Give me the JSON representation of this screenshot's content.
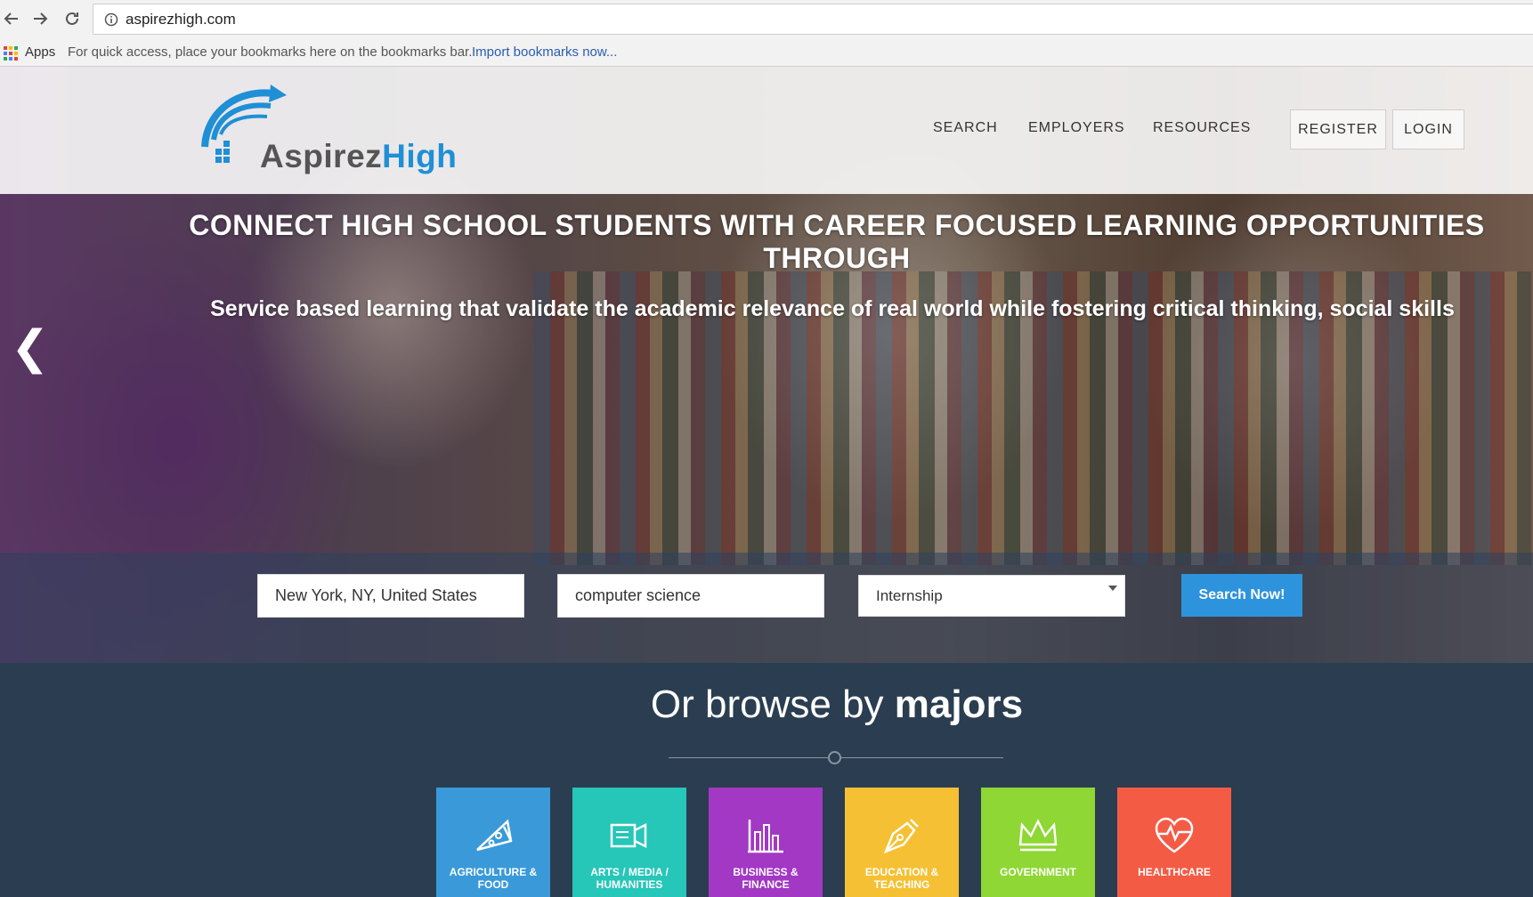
{
  "browser": {
    "url": "aspirezhigh.com",
    "bookmarks_apps_label": "Apps",
    "bookmarks_hint": "For quick access, place your bookmarks here on the bookmarks bar.",
    "bookmarks_import_link": "Import bookmarks now..."
  },
  "site": {
    "logo_text_a": "Aspirez",
    "logo_text_b": "High",
    "nav": {
      "search": "SEARCH",
      "employers": "EMPLOYERS",
      "resources": "RESOURCES",
      "register": "REGISTER",
      "login": "LOGIN"
    }
  },
  "hero": {
    "headline": "CONNECT HIGH SCHOOL STUDENTS WITH CAREER FOCUSED LEARNING OPPORTUNITIES THROUGH",
    "subline": "Service based learning that validate the academic relevance of real world while fostering critical thinking, social skills",
    "prev_arrow": "❮"
  },
  "search": {
    "location_value": "New York, NY, United States",
    "keyword_value": "computer science",
    "type_selected": "Internship",
    "button_label": "Search Now!"
  },
  "browse": {
    "title_prefix": "Or browse by",
    "title_bold": "majors",
    "majors": [
      {
        "label": "AGRICULTURE & FOOD",
        "icon": "pizza-slice-icon",
        "color": "#3a9ad9"
      },
      {
        "label": "ARTS / MEDIA / HUMANITIES",
        "icon": "media-icon",
        "color": "#26c6b9"
      },
      {
        "label": "BUSINESS & FINANCE",
        "icon": "bar-chart-icon",
        "color": "#a238c4"
      },
      {
        "label": "EDUCATION & TEACHING",
        "icon": "pen-nib-icon",
        "color": "#f5c033"
      },
      {
        "label": "GOVERNMENT",
        "icon": "crown-icon",
        "color": "#8ed734"
      },
      {
        "label": "HEALTHCARE",
        "icon": "heart-pulse-icon",
        "color": "#f45b45"
      }
    ]
  },
  "colors": {
    "accent_blue": "#2e93dd",
    "browse_bg": "#2b3d50"
  }
}
